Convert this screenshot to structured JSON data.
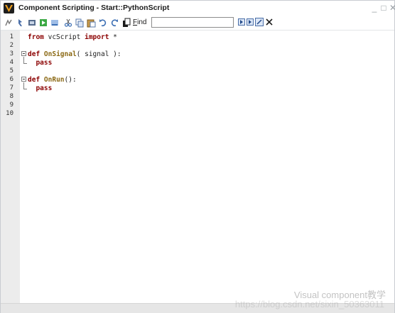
{
  "window": {
    "title": "Component Scripting - Start::PythonScript",
    "minimize": "_",
    "maximize": "□",
    "close": "✕"
  },
  "toolbar": {
    "find_label_prefix": "",
    "find_label_accel": "F",
    "find_label_rest": "ind",
    "find_value": "",
    "buttons": [
      "compile",
      "run",
      "stop",
      "step",
      "new",
      "cut",
      "copy",
      "paste",
      "undo",
      "redo",
      "delete"
    ]
  },
  "editor": {
    "line_numbers": [
      "1",
      "2",
      "3",
      "4",
      "5",
      "6",
      "7",
      "8",
      "9",
      "10"
    ],
    "lines": [
      [
        {
          "t": "from",
          "c": "kw"
        },
        {
          "t": " vcScript ",
          "c": ""
        },
        {
          "t": "import",
          "c": "kw"
        },
        {
          "t": " *",
          "c": ""
        }
      ],
      [],
      [
        {
          "t": "def",
          "c": "kw"
        },
        {
          "t": " ",
          "c": ""
        },
        {
          "t": "OnSignal",
          "c": "fn"
        },
        {
          "t": "( signal ):",
          "c": ""
        }
      ],
      [
        {
          "t": "  ",
          "c": ""
        },
        {
          "t": "pass",
          "c": "kw"
        }
      ],
      [],
      [
        {
          "t": "def",
          "c": "kw"
        },
        {
          "t": " ",
          "c": ""
        },
        {
          "t": "OnRun",
          "c": "fn"
        },
        {
          "t": "():",
          "c": ""
        }
      ],
      [
        {
          "t": "  ",
          "c": ""
        },
        {
          "t": "pass",
          "c": "kw"
        }
      ],
      [],
      [],
      []
    ]
  },
  "watermark": {
    "brand": "Visual component教学",
    "url": "https://blog.csdn.net/sixin_50363011"
  },
  "colors": {
    "keyword": "#8b0000",
    "function": "#8b6914",
    "gutter": "#ececec"
  }
}
